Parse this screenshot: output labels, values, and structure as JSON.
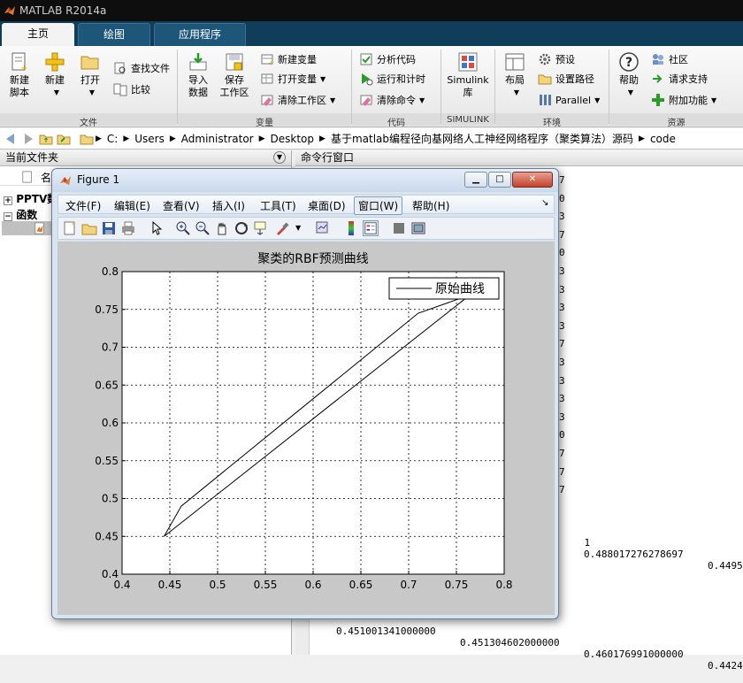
{
  "app": {
    "title": "MATLAB R2014a"
  },
  "tabs": [
    {
      "label": "主页",
      "active": true
    },
    {
      "label": "绘图",
      "active": false
    },
    {
      "label": "应用程序",
      "active": false
    }
  ],
  "ribbon": {
    "file": {
      "label": "文件",
      "new_script": "新建\n脚本",
      "new": "新建",
      "open": "打开",
      "find_files": "查找文件",
      "compare": "比较"
    },
    "variable": {
      "label": "变量",
      "import": "导入\n数据",
      "save_ws": "保存\n工作区",
      "new_var": "新建变量",
      "open_var": "打开变量",
      "clear_ws": "清除工作区"
    },
    "code": {
      "label": "代码",
      "analyze": "分析代码",
      "run_time": "运行和计时",
      "clear_cmd": "清除命令"
    },
    "simulink": {
      "label": "SIMULINK",
      "lib": "Simulink\n库"
    },
    "env": {
      "label": "环境",
      "layout": "布局",
      "prefs": "预设",
      "set_path": "设置路径",
      "parallel": "Parallel"
    },
    "resources": {
      "label": "资源",
      "help": "帮助",
      "community": "社区",
      "support": "请求支持",
      "addons": "附加功能"
    }
  },
  "address": {
    "crumbs": [
      "C:",
      "Users",
      "Administrator",
      "Desktop",
      "基于matlab编程径向基网络人工神经网络程序（聚类算法）源码",
      "code"
    ]
  },
  "left_panel": {
    "title": "当前文件夹",
    "col_name": "名",
    "tree": [
      {
        "toggle": "+",
        "label": "PPTV数"
      },
      {
        "toggle": "−",
        "label": "函数"
      }
    ]
  },
  "right_panel": {
    "title": "命令行窗口",
    "digits": [
      "7",
      "0",
      "3",
      "7",
      "0",
      "3",
      "3",
      "3",
      "3",
      "7",
      "3",
      "3",
      "3",
      "3",
      "0",
      "7",
      "7",
      "7"
    ],
    "row1": [
      "1",
      "0.488017276278697",
      "0.4495"
    ],
    "row2": [
      "0.451001341000000",
      "0.451304602000000",
      "0.460176991000000",
      "0.4424"
    ]
  },
  "figure": {
    "title": "Figure 1",
    "menus": [
      "文件(F)",
      "编辑(E)",
      "查看(V)",
      "插入(I)",
      "工具(T)",
      "桌面(D)",
      "窗口(W)",
      "帮助(H)"
    ],
    "active_menu": "窗口(W)",
    "menu_end": "↘"
  },
  "chart_data": {
    "type": "line",
    "title": "聚类的RBF预测曲线",
    "xlabel": "",
    "ylabel": "",
    "xlim": [
      0.4,
      0.8
    ],
    "ylim": [
      0.4,
      0.8
    ],
    "xticks": [
      "0.4",
      "0.45",
      "0.5",
      "0.55",
      "0.6",
      "0.65",
      "0.7",
      "0.75",
      "0.8"
    ],
    "yticks": [
      "0.4",
      "0.45",
      "0.5",
      "0.55",
      "0.6",
      "0.65",
      "0.7",
      "0.75",
      "0.8"
    ],
    "grid": true,
    "legend": {
      "placement": "top-right",
      "entries": [
        "原始曲线"
      ]
    },
    "series": [
      {
        "name": "原始曲线",
        "color": "#000000",
        "x": [
          0.444,
          0.462,
          0.71,
          0.755
        ],
        "y": [
          0.45,
          0.49,
          0.745,
          0.765
        ]
      },
      {
        "name": "",
        "color": "#000000",
        "x": [
          0.444,
          0.76
        ],
        "y": [
          0.45,
          0.765
        ]
      }
    ]
  }
}
